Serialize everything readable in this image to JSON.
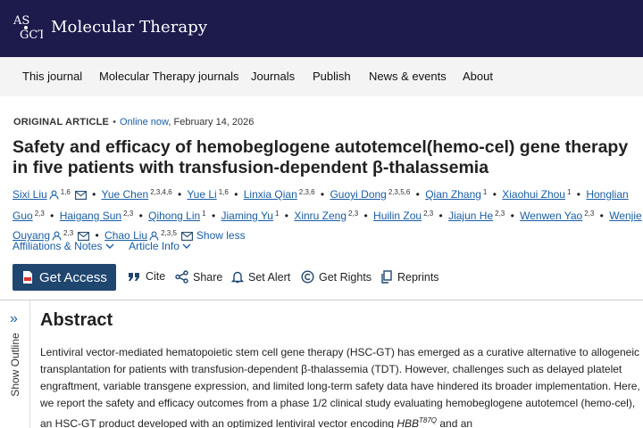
{
  "header": {
    "logo_text": "ASGCT",
    "brand": "Molecular Therapy"
  },
  "nav": [
    {
      "label": "This journal"
    },
    {
      "label": "Molecular Therapy journals"
    },
    {
      "label": "Journals"
    },
    {
      "label": "Publish"
    },
    {
      "label": "News & events"
    },
    {
      "label": "About"
    }
  ],
  "article": {
    "type": "ORIGINAL ARTICLE",
    "online_label": "Online now",
    "date": ", February 14, 2026",
    "title": "Safety and efficacy of hemobeglogene autotemcel(hemo-cel) gene therapy in five patients with transfusion-dependent β-thalassemia",
    "authors": [
      {
        "name": "Sixi Liu",
        "aff": "1,6",
        "person_icon": true,
        "mail_icon": true
      },
      {
        "name": "Yue Chen",
        "aff": "2,3,4,6"
      },
      {
        "name": "Yue Li",
        "aff": "1,6"
      },
      {
        "name": "Linxia Qian",
        "aff": "2,3,6"
      },
      {
        "name": "Guoyi Dong",
        "aff": "2,3,5,6"
      },
      {
        "name": "Qian Zhang",
        "aff": "1"
      },
      {
        "name": "Xiaohui Zhou",
        "aff": "1"
      },
      {
        "name": "Honglian Guo",
        "aff": "2,3"
      },
      {
        "name": "Haigang Sun",
        "aff": "2,3"
      },
      {
        "name": "Qihong Lin",
        "aff": "1"
      },
      {
        "name": "Jiaming Yu",
        "aff": "1"
      },
      {
        "name": "Xinru Zeng",
        "aff": "2,3"
      },
      {
        "name": "Huilin Zou",
        "aff": "2,3"
      },
      {
        "name": "Jiajun He",
        "aff": "2,3"
      },
      {
        "name": "Wenwen Yao",
        "aff": "2,3"
      },
      {
        "name": "Wenjie Ouyang",
        "aff": "2,3",
        "person_icon": true,
        "mail_icon": true
      },
      {
        "name": "Chao Liu",
        "aff": "2,3,5",
        "person_icon": true,
        "mail_icon": true
      }
    ],
    "show_less": "Show less",
    "affiliations_label": "Affiliations & Notes",
    "article_info_label": "Article Info"
  },
  "toolbar": {
    "get_access": "Get Access",
    "cite": "Cite",
    "share": "Share",
    "set_alert": "Set Alert",
    "get_rights": "Get Rights",
    "reprints": "Reprints"
  },
  "sidebar": {
    "show_outline": "Show Outline"
  },
  "abstract": {
    "heading": "Abstract",
    "text_before_gene": "Lentiviral vector-mediated hematopoietic stem cell gene therapy (HSC-GT) has emerged as a curative alternative to allogeneic transplantation for patients with transfusion-dependent β-thalassemia (TDT). However, challenges such as delayed platelet engraftment, variable transgene expression, and limited long-term safety data have hindered its broader implementation. Here, we report the safety and efficacy outcomes from a phase 1/2 clinical study evaluating hemobeglogene autotemcel (hemo-cel), an HSC-GT product developed with an optimized lentiviral vector encoding ",
    "gene": "HBB",
    "gene_sup": "T87Q",
    "text_after_gene": " and an"
  },
  "colors": {
    "header_bg": "#1d1b4c",
    "nav_bg": "#f4f4f4",
    "link": "#1a5ea6",
    "get_access_bg": "#1f466f"
  }
}
